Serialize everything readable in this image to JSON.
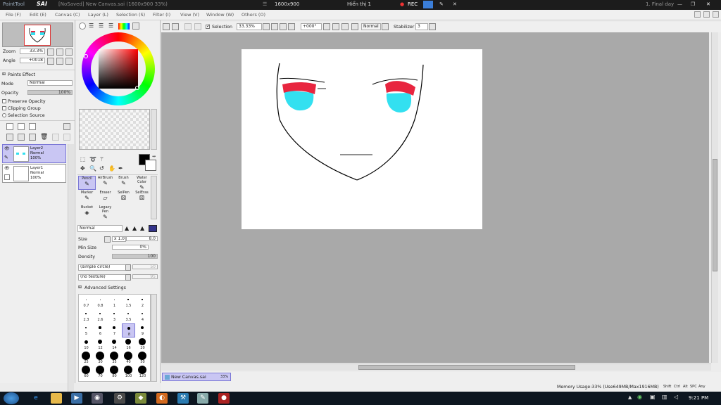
{
  "title_bar": {
    "app_name": "PaintTool",
    "app_logo": "SAI",
    "document": "[NoSaved] New Canvas.sai (1600x900 33%)",
    "screen_recorder": {
      "size": "1600x900",
      "display": "Hiển thị 1",
      "rec_label": "REC"
    },
    "right_status": "1. Final day"
  },
  "menu": [
    "File (F)",
    "Edit (E)",
    "Canvas (C)",
    "Layer (L)",
    "Selection (S)",
    "Filter (I)",
    "View (V)",
    "Window (W)",
    "Others (O)"
  ],
  "navigator": {
    "zoom_label": "Zoom",
    "zoom_value": "33.3%",
    "angle_label": "Angle",
    "angle_value": "+0018"
  },
  "layer_props": {
    "paint_effect": "Paints Effect",
    "mode_label": "Mode",
    "mode_value": "Normal",
    "opacity_label": "Opacity",
    "opacity_value": "100%",
    "preserve_opacity": "Preserve Opacity",
    "clipping_group": "Clipping Group",
    "selection_source": "Selection Source"
  },
  "layers": [
    {
      "name": "Layer2",
      "mode": "Normal",
      "opacity": "100%",
      "selected": true
    },
    {
      "name": "Layer1",
      "mode": "Normal",
      "opacity": "100%",
      "selected": false
    }
  ],
  "tools": [
    {
      "label": "Pencil",
      "selected": true
    },
    {
      "label": "AirBrush"
    },
    {
      "label": "Brush"
    },
    {
      "label": "Water Color"
    },
    {
      "label": "Marker"
    },
    {
      "label": "Eraser"
    },
    {
      "label": "SelPen"
    },
    {
      "label": "SelEras"
    },
    {
      "label": "Bucket"
    },
    {
      "label": "Legacy Pen"
    }
  ],
  "brush_settings": {
    "blend_mode": "Normal",
    "size_label": "Size",
    "size_multiplier": "x 1.0",
    "size_value": "8.0",
    "min_size_label": "Min Size",
    "min_size_value": "0%",
    "density_label": "Density",
    "density_value": "100",
    "shape": "(simple circle)",
    "shape_value": "50",
    "texture": "(no texture)",
    "texture_value": "95",
    "advanced": "Advanced Settings"
  },
  "brush_sizes": [
    "0.7",
    "0.8",
    "1",
    "1.5",
    "2",
    "2.3",
    "2.6",
    "3",
    "3.5",
    "4",
    "5",
    "6",
    "7",
    "8",
    "9",
    "10",
    "12",
    "14",
    "16",
    "20",
    "25",
    "30",
    "35",
    "40",
    "50",
    "60",
    "70",
    "80",
    "100",
    "120"
  ],
  "selected_brush_size": "8",
  "top_toolbar": {
    "selection_label": "Selection",
    "zoom": "33.33%",
    "angle": "+000°",
    "mode": "Normal",
    "stabilizer_label": "Stabilizer",
    "stabilizer_value": "3"
  },
  "status": {
    "tab_name": "New Canvas.sai",
    "tab_zoom": "33%",
    "memory": "Memory Usage:33% (Use649MB/Max1916MB)",
    "keys": [
      "Shift",
      "Ctrl",
      "Alt",
      "SPC",
      "Any"
    ]
  },
  "taskbar": {
    "time": "9:21 PM"
  },
  "colors": {
    "layer_selected": "#c9c6f3",
    "canvas_bg": "#a9a9a9",
    "eye_fill": "#33e0f0",
    "eye_brow": "#e8253f"
  }
}
